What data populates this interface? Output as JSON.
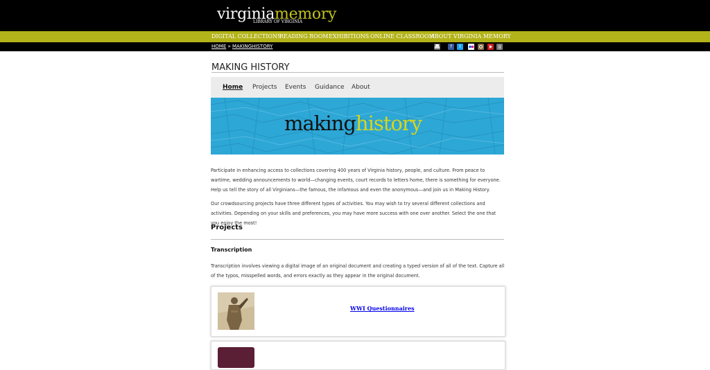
{
  "logo": {
    "word1": "virginia",
    "word2": "memory",
    "tagline": "LIBRARY OF VIRGINIA"
  },
  "nav": {
    "items": [
      "DIGITAL COLLECTIONS",
      "READING ROOM",
      "EXHIBITIONS",
      "ONLINE CLASSROOM",
      "ABOUT VIRGINIA MEMORY"
    ]
  },
  "breadcrumb": {
    "home": "HOME",
    "separator": "»",
    "current": "MAKINGHISTORY"
  },
  "social": {
    "icons": [
      "print-icon",
      "facebook-icon",
      "twitter-icon",
      "flickr-icon",
      "instagram-icon",
      "youtube-icon",
      "google-icon"
    ]
  },
  "page": {
    "title": "MAKING HISTORY"
  },
  "menu": {
    "items": [
      "Home",
      "Projects",
      "Events",
      "Guidance",
      "About"
    ],
    "active": "Home"
  },
  "banner": {
    "word1": "making",
    "word2": "history"
  },
  "intro": {
    "p1": "Participate in enhancing access to collections covering 400 years of Virginia history, people, and culture. From peace to wartime, wedding announcements to world—changing events, court records to letters home, there is something for everyone. Help us tell the story of all Virginians—the famous, the infamous and even the anonymous—and join us in Making History.",
    "p2": "Our crowdsourcing projects have three different types of activities. You may wish to try several different collections and activities. Depending on your skills and preferences, you may have more success with one over another. Select the one that you enjoy the most!"
  },
  "projects": {
    "heading": "Projects",
    "transcription": {
      "heading": "Transcription",
      "description": "Transcription involves viewing a digital image of an original document and creating a typed version of all of the text. Capture all of the typos, misspelled words, and errors exactly as they appear in the original document."
    },
    "cards": [
      {
        "link": "WWI Questionnaires"
      }
    ]
  },
  "colors": {
    "nav_bar": "#b3b31a",
    "accent_logo": "#c2c21c",
    "banner_bg": "#2da7d6",
    "banner_history": "#d8d41a"
  }
}
